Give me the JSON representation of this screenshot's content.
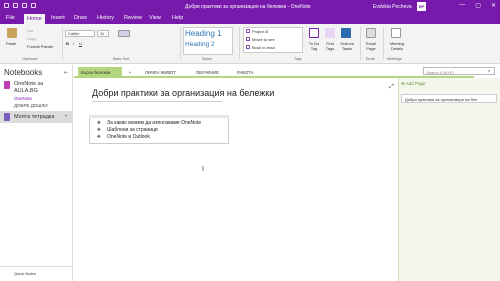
{
  "window": {
    "title": "Добри практики за организация на бележки  -  OneNote",
    "user": "Evdokia Pecheva",
    "avatar_initials": "EP",
    "controls": [
      "—",
      "▢",
      "✕"
    ]
  },
  "tabs": [
    "File",
    "Home",
    "Insert",
    "Draw",
    "History",
    "Review",
    "View",
    "Help"
  ],
  "ribbon": {
    "clipboard": {
      "paste": "Paste",
      "cut": "Cut",
      "copy": "Copy",
      "format_painter": "Format Painter",
      "label": "Clipboard"
    },
    "basic_text": {
      "font": "Calibri",
      "size": "11",
      "label": "Basic Text"
    },
    "styles": {
      "heading1": "Heading 1",
      "heading2": "Heading 2",
      "label": "Styles"
    },
    "tags": {
      "items": [
        "Project B",
        "Movie to see",
        "Book to read"
      ],
      "todo_tag": "To Do Tag",
      "find_tags": "Find Tags",
      "outlook_tasks": "Outlook Tasks",
      "label": "Tags"
    },
    "email": {
      "email_page": "Email Page",
      "label": "Email"
    },
    "meetings": {
      "meeting_details": "Meeting Details",
      "label": "Meetings"
    }
  },
  "notebooks": {
    "header": "Notebooks",
    "items": [
      {
        "name": "OneNote за AULA.BG",
        "sub": "OneNote",
        "sub2": "ДОБРЕ ДОШЛИ",
        "color": "#c13bb1"
      },
      {
        "name": "Моята тетрадка",
        "color": "#7d5cc2"
      }
    ],
    "quick_notes": "Quick Notes"
  },
  "sections": {
    "tabs": [
      "Бързи бележки",
      "ЛИЧЕН ЖИВОТ",
      "ОБУЧЕНИЕ",
      "РАБОТА"
    ],
    "add": "+",
    "search_placeholder": "Search (Ctrl+E)"
  },
  "page": {
    "title": "Добри практики за организация на бележки",
    "bullets": [
      "За какво можем да използваме OneNote",
      "Шаблони за страници",
      "OneNote и Outlook"
    ]
  },
  "pages_panel": {
    "add_page": "Add Page",
    "items": [
      "Добри практики за организация на бел"
    ]
  }
}
